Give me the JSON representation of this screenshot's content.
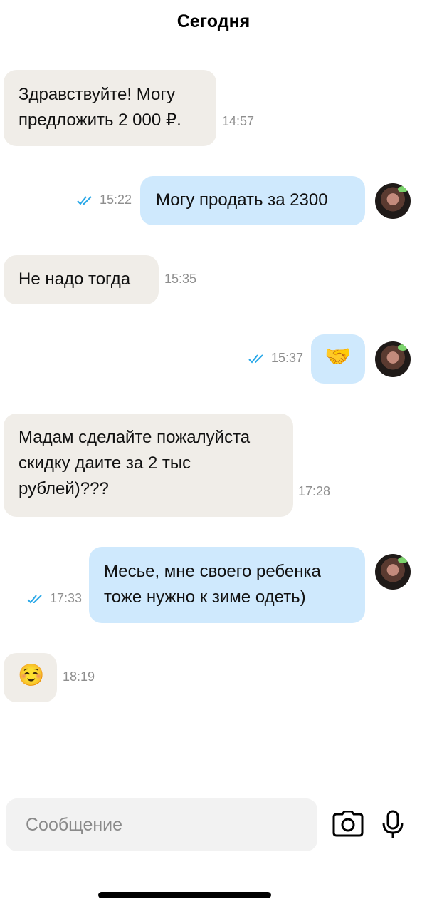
{
  "header": {
    "date_label": "Сегодня"
  },
  "messages": [
    {
      "direction": "in",
      "text_lines": [
        "Здравствуйте! Могу",
        "предложить 2 000 ₽."
      ],
      "time": "14:57"
    },
    {
      "direction": "out",
      "text_lines": [
        "Могу продать за 2300"
      ],
      "time": "15:22",
      "status": "read"
    },
    {
      "direction": "in",
      "text_lines": [
        "Не надо тогда"
      ],
      "time": "15:35"
    },
    {
      "direction": "out",
      "emoji": "🤝",
      "time": "15:37",
      "status": "read"
    },
    {
      "direction": "in",
      "text_lines": [
        "Мадам сделайте пожалуйста",
        "скидку даите за 2 тыс",
        "рублей)???"
      ],
      "time": "17:28"
    },
    {
      "direction": "out",
      "text_lines": [
        "Месье, мне своего ребенка",
        "тоже нужно к зиме одеть)"
      ],
      "time": "17:33",
      "status": "read"
    },
    {
      "direction": "in",
      "emoji": "☺️",
      "time": "18:19"
    }
  ],
  "composer": {
    "placeholder": "Сообщение",
    "camera_icon": "camera-icon",
    "mic_icon": "microphone-icon"
  },
  "colors": {
    "incoming_bubble": "#f0ede8",
    "outgoing_bubble": "#cfe9fd",
    "read_check": "#2aa8e8"
  }
}
